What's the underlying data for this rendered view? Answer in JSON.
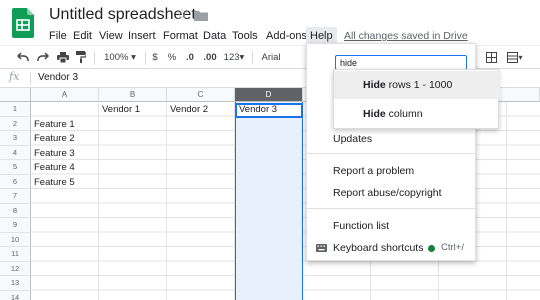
{
  "app": {
    "doc_title": "Untitled spreadsheet",
    "brand_color": "#0f9d58"
  },
  "menubar": {
    "items": [
      {
        "label": "File"
      },
      {
        "label": "Edit"
      },
      {
        "label": "View"
      },
      {
        "label": "Insert"
      },
      {
        "label": "Format"
      },
      {
        "label": "Data"
      },
      {
        "label": "Tools"
      },
      {
        "label": "Add-ons"
      },
      {
        "label": "Help"
      }
    ],
    "active_item": "Help",
    "saved_status": "All changes saved in Drive"
  },
  "toolbar": {
    "icons": [
      "undo-icon",
      "redo-icon",
      "print-icon",
      "paint-format-icon"
    ],
    "zoom": "100%",
    "currency": "$",
    "percent": "%",
    "decrease_decimals": ".0",
    "increase_decimals": ".00",
    "more_formats": "123",
    "font": "Arial"
  },
  "formula_bar": {
    "fx": "fx",
    "value": "Vendor 3"
  },
  "grid": {
    "columns": [
      "A",
      "B",
      "C",
      "D"
    ],
    "selected_column": "D",
    "rows": [
      "1",
      "2",
      "3",
      "4",
      "5",
      "6",
      "7",
      "8",
      "9",
      "10",
      "11",
      "12",
      "13",
      "14"
    ],
    "header_row": [
      "",
      "Vendor 1",
      "Vendor 2",
      "Vendor 3"
    ],
    "features": [
      "Feature 1",
      "Feature 2",
      "Feature 3",
      "Feature 4",
      "Feature 5"
    ],
    "selection_color": "#1a73e8"
  },
  "help_menu": {
    "search_value": "hide",
    "results": [
      {
        "bold": "Hide",
        "rest": " rows 1 - 1000"
      },
      {
        "bold": "Hide",
        "rest": " column"
      }
    ],
    "items": {
      "updates": "Updates",
      "report_problem": "Report a problem",
      "report_abuse": "Report abuse/copyright",
      "function_list": "Function list",
      "keyboard_shortcuts": "Keyboard shortcuts",
      "shortcut_keys": "Ctrl+/"
    }
  }
}
